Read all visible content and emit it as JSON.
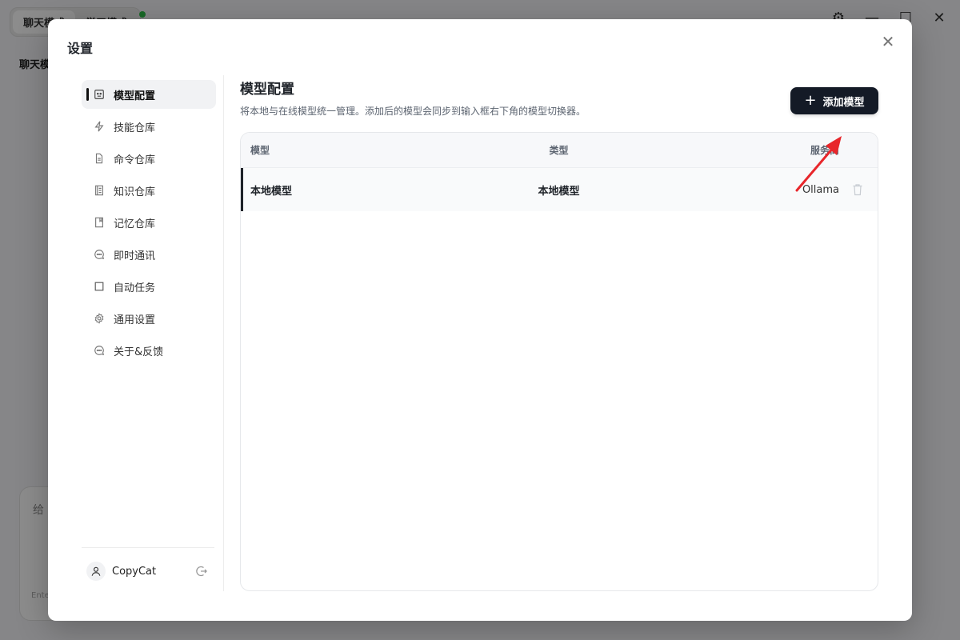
{
  "background": {
    "mode_tabs": [
      "聊天模式",
      "学习模式"
    ],
    "chat_title": "聊天模",
    "input_placeholder": "给",
    "input_hint": "Ente"
  },
  "modal": {
    "title": "设置",
    "close_icon": "close-icon"
  },
  "sidebar": {
    "items": [
      {
        "label": "模型配置",
        "icon": "model-icon",
        "active": true
      },
      {
        "label": "技能仓库",
        "icon": "lightning-icon"
      },
      {
        "label": "命令仓库",
        "icon": "file-icon"
      },
      {
        "label": "知识仓库",
        "icon": "book-icon"
      },
      {
        "label": "记忆仓库",
        "icon": "bookmark-icon"
      },
      {
        "label": "即时通讯",
        "icon": "chat-bubble-icon"
      },
      {
        "label": "自动任务",
        "icon": "square-icon"
      },
      {
        "label": "通用设置",
        "icon": "gear-icon"
      },
      {
        "label": "关于&反馈",
        "icon": "chat-bubble-icon"
      }
    ],
    "user": {
      "name": "CopyCat"
    }
  },
  "content": {
    "title": "模型配置",
    "description": "将本地与在线模型统一管理。添加后的模型会同步到输入框右下角的模型切换器。",
    "add_button_label": "添加模型",
    "table": {
      "headers": {
        "model": "模型",
        "type": "类型",
        "provider": "服务商"
      },
      "rows": [
        {
          "model": "本地模型",
          "type": "本地模型",
          "provider": "Ollama"
        }
      ]
    }
  },
  "colors": {
    "accent_dark": "#141a26",
    "annotation_arrow": "#e8262b",
    "status_online": "#2fbf4a"
  }
}
